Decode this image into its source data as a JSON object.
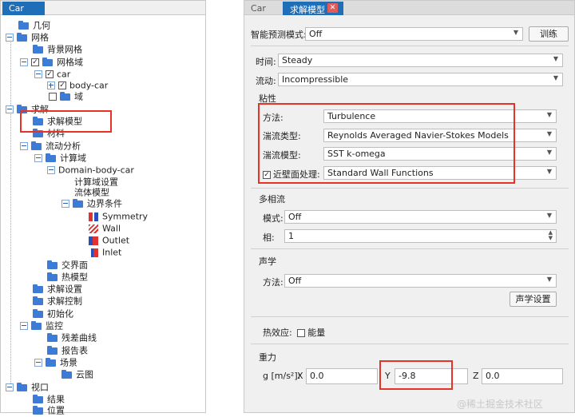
{
  "left_panel": {
    "tab_label": "Car",
    "tree": [
      {
        "label": "几何",
        "icon": "folder-icon"
      },
      {
        "label": "网格",
        "icon": "folder-icon"
      },
      {
        "label": "背景网格",
        "icon": "folder-icon"
      },
      {
        "label": "网格域",
        "icon": "folder-icon"
      },
      {
        "label": "car",
        "icon": "folder-icon"
      },
      {
        "label": "body-car",
        "icon": "folder-icon"
      },
      {
        "label": "域",
        "icon": "folder-icon"
      },
      {
        "label": "求解",
        "icon": "folder-icon"
      },
      {
        "label": "求解模型",
        "icon": "folder-icon"
      },
      {
        "label": "材料",
        "icon": "folder-icon"
      },
      {
        "label": "流动分析",
        "icon": "folder-icon"
      },
      {
        "label": "计算域",
        "icon": "folder-icon"
      },
      {
        "label": "Domain-body-car",
        "icon": "folder-icon"
      },
      {
        "label": "计算域设置",
        "icon": "folder-icon"
      },
      {
        "label": "流体模型",
        "icon": "folder-icon"
      },
      {
        "label": "边界条件",
        "icon": "folder-icon"
      },
      {
        "label": "Symmetry",
        "icon": "symmetry-bc-icon"
      },
      {
        "label": "Wall",
        "icon": "wall-bc-icon"
      },
      {
        "label": "Outlet",
        "icon": "outlet-bc-icon"
      },
      {
        "label": "Inlet",
        "icon": "inlet-bc-icon"
      },
      {
        "label": "交界面",
        "icon": "folder-icon"
      },
      {
        "label": "热模型",
        "icon": "folder-icon"
      },
      {
        "label": "求解设置",
        "icon": "folder-icon"
      },
      {
        "label": "求解控制",
        "icon": "folder-icon"
      },
      {
        "label": "初始化",
        "icon": "folder-icon"
      },
      {
        "label": "监控",
        "icon": "folder-icon"
      },
      {
        "label": "残差曲线",
        "icon": "folder-icon"
      },
      {
        "label": "报告表",
        "icon": "folder-icon"
      },
      {
        "label": "场景",
        "icon": "folder-icon"
      },
      {
        "label": "云图",
        "icon": "folder-icon"
      },
      {
        "label": "视口",
        "icon": "folder-icon"
      },
      {
        "label": "结果",
        "icon": "folder-icon"
      },
      {
        "label": "位置",
        "icon": "folder-icon"
      }
    ]
  },
  "right_panel": {
    "tabs": [
      "Car",
      "求解模型"
    ],
    "smart_predict": {
      "label": "智能预测模式:",
      "value": "Off",
      "button": "训练"
    },
    "time": {
      "label": "时间:",
      "value": "Steady"
    },
    "flow": {
      "label": "流动:",
      "value": "Incompressible"
    },
    "viscosity": {
      "title": "粘性",
      "method": {
        "label": "方法:",
        "value": "Turbulence"
      },
      "turb_type": {
        "label": "湍流类型:",
        "value": "Reynolds Averaged Navier-Stokes Models"
      },
      "turb_model": {
        "label": "湍流模型:",
        "value": "SST k-omega"
      },
      "wall_treatment": {
        "label": "近壁面处理:",
        "value": "Standard Wall Functions",
        "checked": true
      }
    },
    "multiphase": {
      "title": "多相流",
      "mode": {
        "label": "模式:",
        "value": "Off"
      },
      "phase": {
        "label": "相:",
        "value": "1"
      }
    },
    "acoustics": {
      "title": "声学",
      "method": {
        "label": "方法:",
        "value": "Off"
      },
      "button": "声学设置"
    },
    "thermal": {
      "label": "热效应:",
      "energy_label": "能量",
      "checked": false
    },
    "gravity": {
      "title": "重力",
      "label": "g [m/s²]:",
      "x_label": "X",
      "x": "0.0",
      "y_label": "Y",
      "y": "-9.8",
      "z_label": "Z",
      "z": "0.0"
    }
  },
  "watermark": "@稀土掘金技术社区",
  "colors": {
    "accent": "#1e6fb8",
    "highlight": "#e5332a"
  }
}
